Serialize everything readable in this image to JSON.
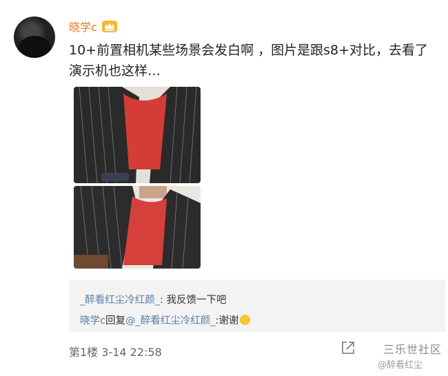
{
  "post": {
    "username": "晓学c",
    "content": "10+前置相机某些场景会发白啊 ，图片是跟s8+对比，去看了演示机也这样…",
    "images": [
      "photo-1",
      "photo-2"
    ]
  },
  "comments": [
    {
      "author": "_醉看红尘冷红颜_",
      "separator": ": ",
      "text": "我反馈一下吧"
    },
    {
      "author": "晓学c",
      "reply_word": "回复",
      "reply_to": "@_醉看红尘冷红颜_",
      "separator": ":",
      "text": "谢谢"
    }
  ],
  "meta": {
    "floor_time": "第1楼  3-14 22:58"
  },
  "forum_mark": "三乐世社区",
  "watermark": "@醉看红尘",
  "colors": {
    "username": "#e8791b",
    "link": "#5a7fa8",
    "comment_bg": "#f3f3f3"
  },
  "icons": [
    "crown-icon",
    "share-icon",
    "emoji-icon"
  ]
}
